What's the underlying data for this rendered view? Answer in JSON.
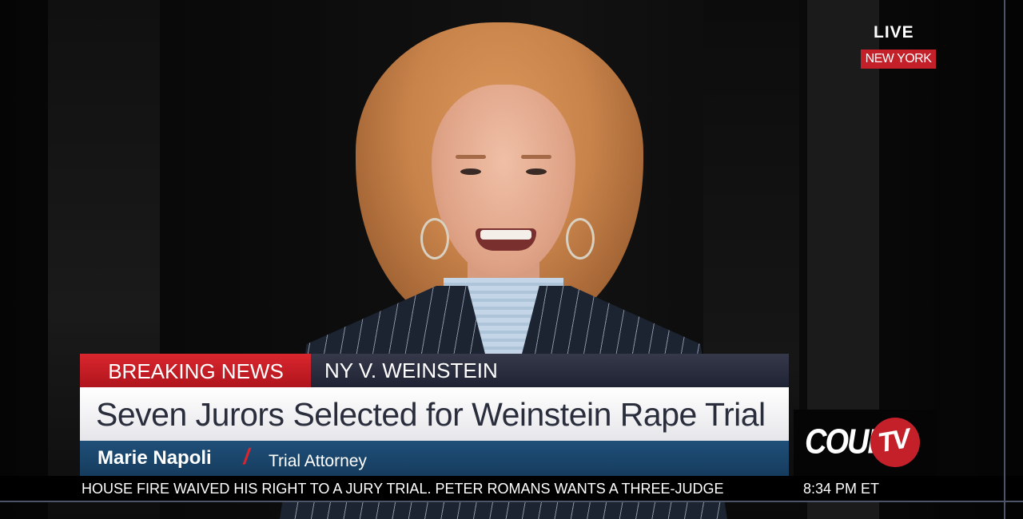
{
  "bug": {
    "live_label": "LIVE",
    "location": "NEW YORK"
  },
  "lower_third": {
    "breaking_label": "BREAKING NEWS",
    "topic": "NY V. WEINSTEIN",
    "headline": "Seven Jurors Selected for Weinstein Rape Trial",
    "guest_name": "Marie Napoli",
    "guest_title": "Trial Attorney"
  },
  "ticker": {
    "text": "A HOUSE FIRE WAIVED HIS RIGHT TO A JURY TRIAL.  PETER ROMANS WANTS A THREE-JUDGE",
    "time": "8:34 PM ET"
  },
  "logo": {
    "word": "COURT",
    "badge": "TV"
  },
  "colors": {
    "accent_red": "#c3202a",
    "name_bar_blue": "#1f4f78",
    "headline_text": "#2a2e3c"
  }
}
